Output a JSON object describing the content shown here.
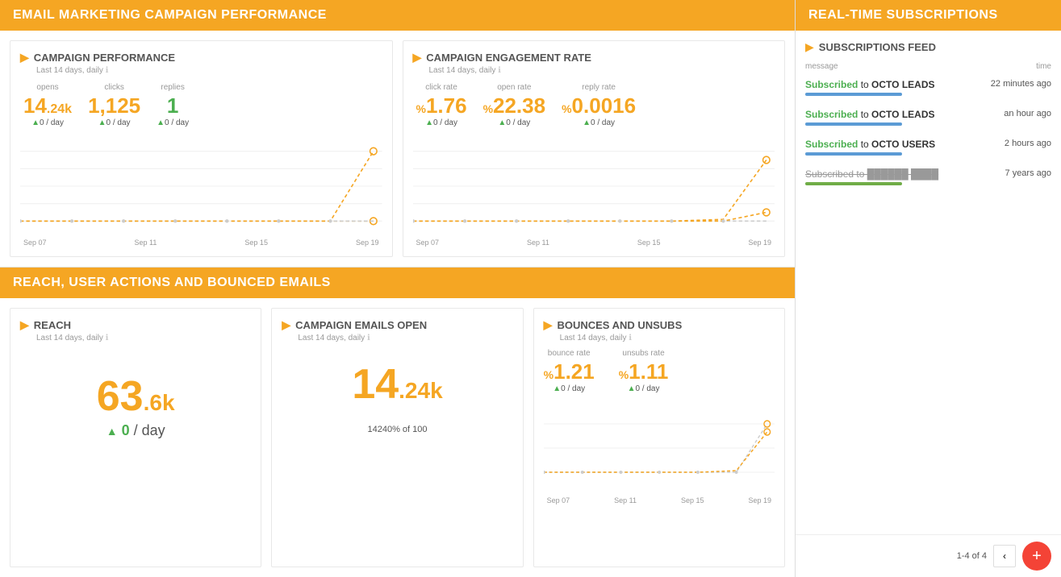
{
  "app": {
    "title": "EMAIL MARKETING CAMPAIGN PERFORMANCE",
    "realtime_title": "REAL-TIME SUBSCRIPTIONS"
  },
  "campaign_performance": {
    "title": "CAMPAIGN PERFORMANCE",
    "subtitle": "Last 14 days, daily",
    "opens_label": "opens",
    "clicks_label": "clicks",
    "replies_label": "replies",
    "opens_value": "14",
    "opens_suffix": ".24k",
    "opens_per_day": "0 / day",
    "clicks_value": "1,125",
    "clicks_per_day": "0 / day",
    "replies_value": "1",
    "replies_per_day": "0 / day",
    "dates": [
      "Sep 07",
      "Sep 11",
      "Sep 15",
      "Sep 19"
    ]
  },
  "engagement_rate": {
    "title": "CAMPAIGN ENGAGEMENT RATE",
    "subtitle": "Last 14 days, daily",
    "click_rate_label": "click rate",
    "open_rate_label": "open rate",
    "reply_rate_label": "reply rate",
    "click_rate_value": "1.76",
    "click_rate_per_day": "0 / day",
    "open_rate_value": "22.38",
    "open_rate_per_day": "0 / day",
    "reply_rate_value": "0.0016",
    "reply_rate_per_day": "0 / day",
    "dates": [
      "Sep 07",
      "Sep 11",
      "Sep 15",
      "Sep 19"
    ]
  },
  "bottom_header": "REACH, USER ACTIONS AND BOUNCED EMAILS",
  "reach": {
    "title": "REACH",
    "subtitle": "Last 14 days, daily",
    "value": "63",
    "suffix": ".6k",
    "per_day": "0",
    "per_day_label": "/ day"
  },
  "emails_open": {
    "title": "CAMPAIGN EMAILS OPEN",
    "subtitle": "Last 14 days, daily",
    "value": "14",
    "suffix": ".24k",
    "progress_label": "14240% of 100"
  },
  "bounces": {
    "title": "BOUNCES AND UNSUBS",
    "subtitle": "Last 14 days, daily",
    "bounce_rate_label": "bounce rate",
    "unsubs_rate_label": "unsubs rate",
    "bounce_value": "1.21",
    "bounce_per_day": "0 / day",
    "unsubs_value": "1.11",
    "unsubs_per_day": "0 / day",
    "dates": [
      "Sep 07",
      "Sep 11",
      "Sep 15",
      "Sep 19"
    ]
  },
  "subscriptions": {
    "title": "SUBSCRIPTIONS FEED",
    "col_message": "message",
    "col_time": "time",
    "items": [
      {
        "subscribed_text": "Subscribed",
        "to_text": " to ",
        "list_name": "OCTO LEADS",
        "bar_color": "blue",
        "bar_width": "120",
        "time": "22 minutes ago"
      },
      {
        "subscribed_text": "Subscribed",
        "to_text": " to ",
        "list_name": "OCTO LEADS",
        "bar_color": "blue",
        "bar_width": "120",
        "time": "an hour ago"
      },
      {
        "subscribed_text": "Subscribed",
        "to_text": " to ",
        "list_name": "OCTO USERS",
        "bar_color": "blue",
        "bar_width": "120",
        "time": "2 hours ago"
      },
      {
        "subscribed_text": "Subscribed",
        "to_text": " to ",
        "list_name": "strikethrough",
        "bar_color": "green-bar",
        "bar_width": "120",
        "time": "7 years ago",
        "strikethrough": true
      }
    ],
    "pagination": "1-4 of 4"
  }
}
